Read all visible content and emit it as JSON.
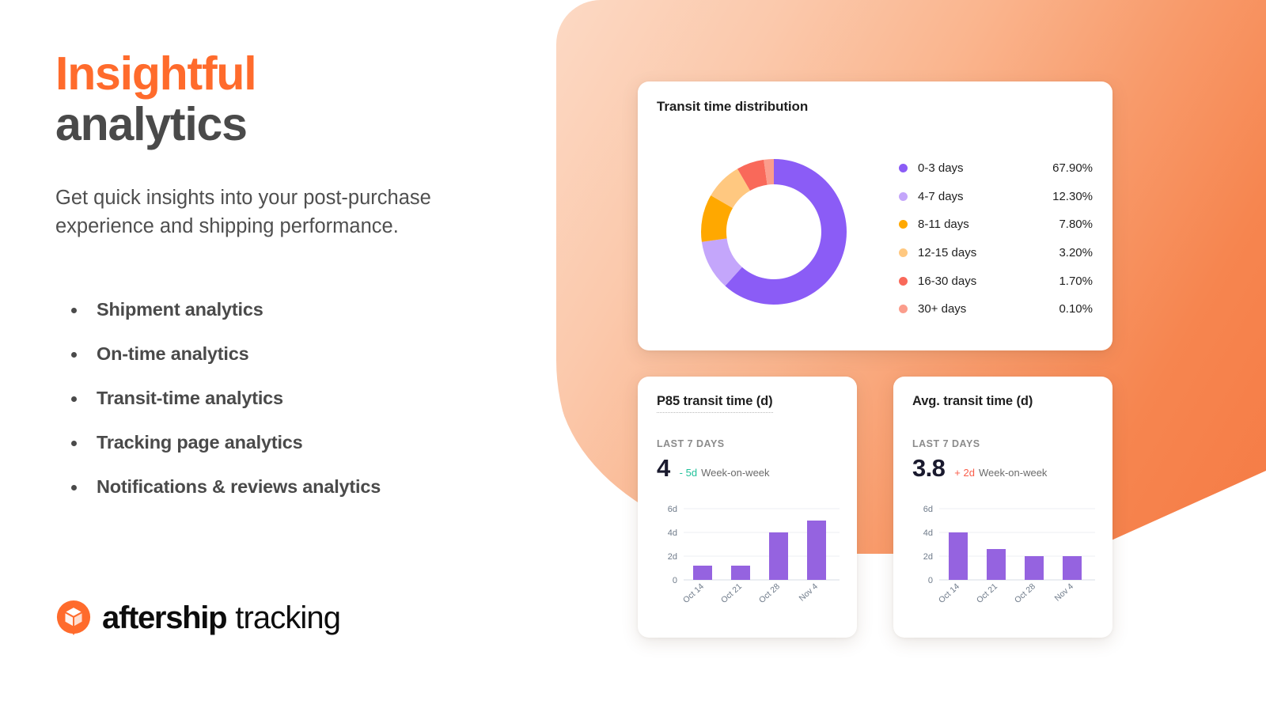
{
  "hero": {
    "headline_line1": "Insightful",
    "headline_line2": "analytics",
    "subcopy": "Get quick insights into your post-purchase experience and shipping performance.",
    "features": [
      "Shipment analytics",
      "On-time analytics",
      "Transit-time analytics",
      "Tracking page analytics",
      "Notifications & reviews analytics"
    ],
    "accent_color": "#ff6b2c",
    "text_color": "#4a4a4a"
  },
  "logo": {
    "mark_icon": "aftership-box-pin-icon",
    "brand": "aftership",
    "product": "tracking",
    "mark_color": "#ff6b2c"
  },
  "cards": {
    "donut": {
      "title": "Transit time distribution"
    },
    "p85": {
      "title": "P85 transit time (d)",
      "period": "LAST 7 DAYS",
      "value": "4",
      "delta": "- 5d",
      "delta_direction": "down",
      "delta_color": "#21c19a",
      "delta_note": "Week-on-week"
    },
    "avg": {
      "title": "Avg. transit time (d)",
      "period": "LAST 7 DAYS",
      "value": "3.8",
      "delta": "+ 2d",
      "delta_direction": "up",
      "delta_color": "#fa5d4a",
      "delta_note": "Week-on-week"
    }
  },
  "chart_data": [
    {
      "type": "pie",
      "title": "Transit time distribution",
      "subtype": "donut",
      "legend_position": "right",
      "categories": [
        "0-3 days",
        "4-7 days",
        "8-11 days",
        "12-15 days",
        "16-30 days",
        "30+ days"
      ],
      "values": [
        67.9,
        12.3,
        7.8,
        3.2,
        1.7,
        0.1
      ],
      "value_labels": [
        "67.90%",
        "12.30%",
        "7.80%",
        "3.20%",
        "1.70%",
        "0.10%"
      ],
      "colors": [
        "#8b5cf6",
        "#c4a6fb",
        "#ffa800",
        "#ffc880",
        "#f9695a",
        "#fb9d8c"
      ],
      "rendered_angles_deg": [
        {
          "name": "0-3 days",
          "start": 0,
          "end": 222
        },
        {
          "name": "4-7 days",
          "start": 222,
          "end": 262
        },
        {
          "name": "8-11 days",
          "start": 262,
          "end": 300
        },
        {
          "name": "12-15 days",
          "start": 300,
          "end": 330
        },
        {
          "name": "16-30 days",
          "start": 330,
          "end": 352
        },
        {
          "name": "30+ days",
          "start": 352,
          "end": 360
        }
      ]
    },
    {
      "type": "bar",
      "title": "P85 transit time (d)",
      "categories": [
        "Oct 14",
        "Oct 21",
        "Oct 28",
        "Nov 4"
      ],
      "values": [
        1.2,
        1.2,
        4.0,
        5.0
      ],
      "ylabel": "",
      "xlabel": "",
      "ylim": [
        0,
        6
      ],
      "yticks": [
        0,
        2,
        4,
        6
      ],
      "ytick_labels": [
        "0",
        "2d",
        "4d",
        "6d"
      ],
      "grid": true,
      "bar_color": "#9563e0"
    },
    {
      "type": "bar",
      "title": "Avg. transit time (d)",
      "categories": [
        "Oct 14",
        "Oct 21",
        "Oct 28",
        "Nov 4"
      ],
      "values": [
        4.0,
        2.6,
        2.0,
        2.0
      ],
      "ylabel": "",
      "xlabel": "",
      "ylim": [
        0,
        6
      ],
      "yticks": [
        0,
        2,
        4,
        6
      ],
      "ytick_labels": [
        "0",
        "2d",
        "4d",
        "6d"
      ],
      "grid": true,
      "bar_color": "#9563e0"
    }
  ]
}
